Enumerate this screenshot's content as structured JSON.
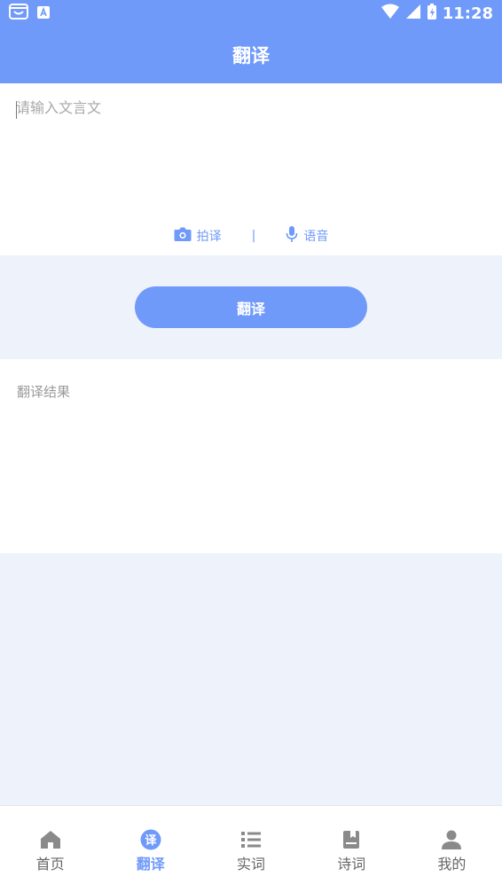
{
  "status": {
    "time": "11:28"
  },
  "header": {
    "title": "翻译"
  },
  "input": {
    "placeholder": "请输入文言文",
    "value": ""
  },
  "tools": {
    "photo_label": "拍译",
    "divider": "|",
    "voice_label": "语音"
  },
  "action": {
    "translate_label": "翻译"
  },
  "result": {
    "label": "翻译结果"
  },
  "nav": {
    "items": [
      {
        "label": "首页",
        "icon": "home-icon"
      },
      {
        "label": "翻译",
        "icon": "translate-icon",
        "badge": "译"
      },
      {
        "label": "实词",
        "icon": "list-icon"
      },
      {
        "label": "诗词",
        "icon": "book-icon"
      },
      {
        "label": "我的",
        "icon": "user-icon"
      }
    ],
    "active_index": 1
  },
  "colors": {
    "accent": "#6f9afa",
    "background": "#eef2fb",
    "inactive_icon": "#8a8a8a"
  }
}
